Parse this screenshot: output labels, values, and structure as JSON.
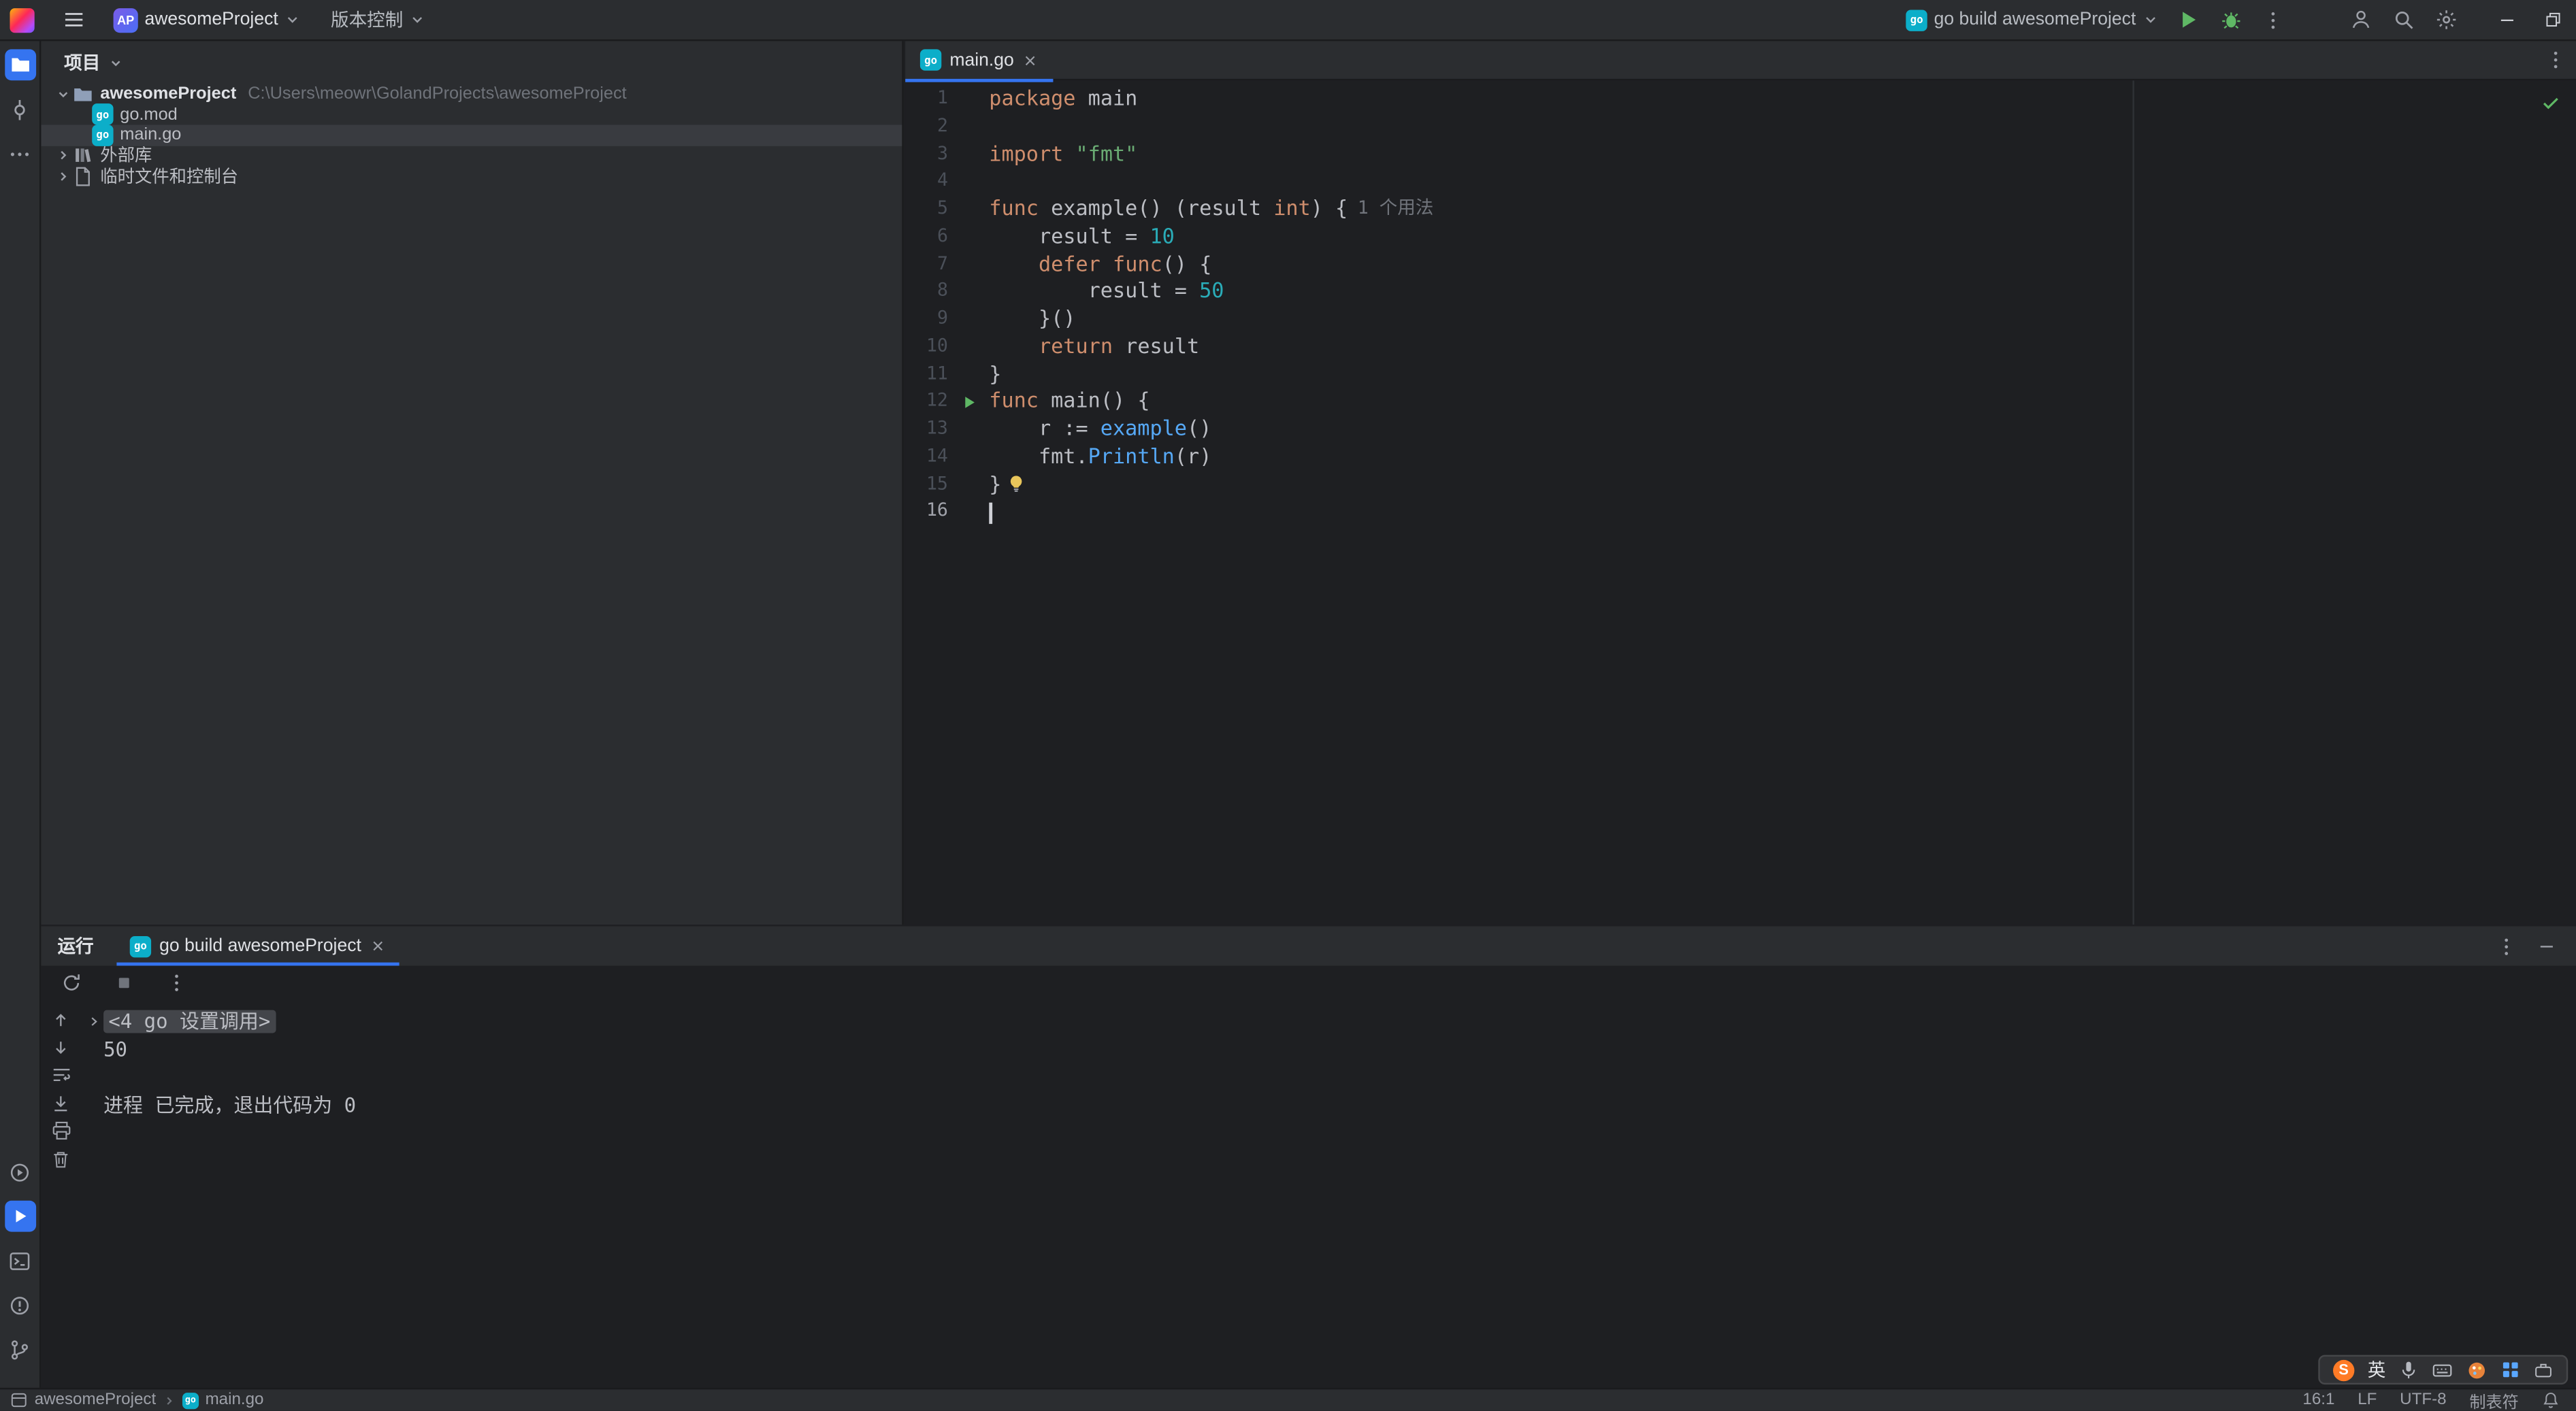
{
  "colors": {
    "accent": "#3574f0",
    "panel_bg": "#2b2d30",
    "editor_bg": "#1e1f22",
    "keyword": "#cf8e6d",
    "string": "#6aab73",
    "number": "#2aacb8",
    "function_call": "#56a8f5",
    "run_green": "#5fb865",
    "go_teal": "#0caec9"
  },
  "titlebar": {
    "project_badge": "AP",
    "project_name": "awesomeProject",
    "vcs_label": "版本控制",
    "run_config_label": "go build awesomeProject"
  },
  "project_panel": {
    "title": "项目",
    "tree": [
      {
        "label": "awesomeProject",
        "suffix": "C:\\Users\\meowr\\GolandProjects\\awesomeProject",
        "icon": "folder",
        "indent": 0,
        "chevron": "down",
        "bold": true,
        "selected": false
      },
      {
        "label": "go.mod",
        "icon": "go",
        "indent": 1,
        "selected": false
      },
      {
        "label": "main.go",
        "icon": "go",
        "indent": 1,
        "selected": true
      },
      {
        "label": "外部库",
        "icon": "library",
        "indent": 0,
        "chevron": "right",
        "selected": false
      },
      {
        "label": "临时文件和控制台",
        "icon": "scratch",
        "indent": 0,
        "chevron": "right",
        "selected": false
      }
    ]
  },
  "editor": {
    "tab_label": "main.go",
    "lines": [
      {
        "n": 1,
        "segs": [
          [
            "k",
            "package"
          ],
          [
            "d",
            " main"
          ]
        ]
      },
      {
        "n": 2,
        "segs": []
      },
      {
        "n": 3,
        "segs": [
          [
            "k",
            "import"
          ],
          [
            "d",
            " "
          ],
          [
            "s",
            "\"fmt\""
          ]
        ]
      },
      {
        "n": 4,
        "segs": []
      },
      {
        "n": 5,
        "segs": [
          [
            "k",
            "func"
          ],
          [
            "d",
            " example() (result "
          ],
          [
            "k",
            "int"
          ],
          [
            "d",
            ") {"
          ],
          [
            "h",
            "1 个用法"
          ]
        ]
      },
      {
        "n": 6,
        "segs": [
          [
            "d",
            "    result = "
          ],
          [
            "n2",
            "10"
          ]
        ]
      },
      {
        "n": 7,
        "segs": [
          [
            "d",
            "    "
          ],
          [
            "k",
            "defer"
          ],
          [
            "d",
            " "
          ],
          [
            "k",
            "func"
          ],
          [
            "d",
            "() {"
          ]
        ]
      },
      {
        "n": 8,
        "segs": [
          [
            "d",
            "        result = "
          ],
          [
            "n2",
            "50"
          ]
        ]
      },
      {
        "n": 9,
        "segs": [
          [
            "d",
            "    }()"
          ]
        ]
      },
      {
        "n": 10,
        "segs": [
          [
            "d",
            "    "
          ],
          [
            "k",
            "return"
          ],
          [
            "d",
            " result"
          ]
        ]
      },
      {
        "n": 11,
        "segs": [
          [
            "d",
            "}"
          ]
        ]
      },
      {
        "n": 12,
        "run": true,
        "segs": [
          [
            "k",
            "func"
          ],
          [
            "d",
            " main() {"
          ]
        ]
      },
      {
        "n": 13,
        "segs": [
          [
            "d",
            "    r := "
          ],
          [
            "f",
            "example"
          ],
          [
            "d",
            "()"
          ]
        ]
      },
      {
        "n": 14,
        "segs": [
          [
            "d",
            "    fmt."
          ],
          [
            "f",
            "Println"
          ],
          [
            "d",
            "(r)"
          ]
        ]
      },
      {
        "n": 15,
        "bulb": true,
        "segs": [
          [
            "d",
            "}"
          ]
        ]
      },
      {
        "n": 16,
        "caret": true,
        "segs": []
      }
    ]
  },
  "run_panel": {
    "title": "运行",
    "tab_label": "go build awesomeProject",
    "console": [
      {
        "fold": true,
        "text": "<4 go 设置调用>"
      },
      {
        "text": "50"
      },
      {
        "text": ""
      },
      {
        "text": "进程 已完成，退出代码为 0"
      }
    ]
  },
  "statusbar": {
    "breadcrumb": [
      "awesomeProject",
      "main.go"
    ],
    "caret_position": "16:1",
    "line_ending": "LF",
    "encoding": "UTF-8",
    "indent": "制表符"
  },
  "ime_bar": {
    "logo": "S",
    "lang": "英"
  }
}
